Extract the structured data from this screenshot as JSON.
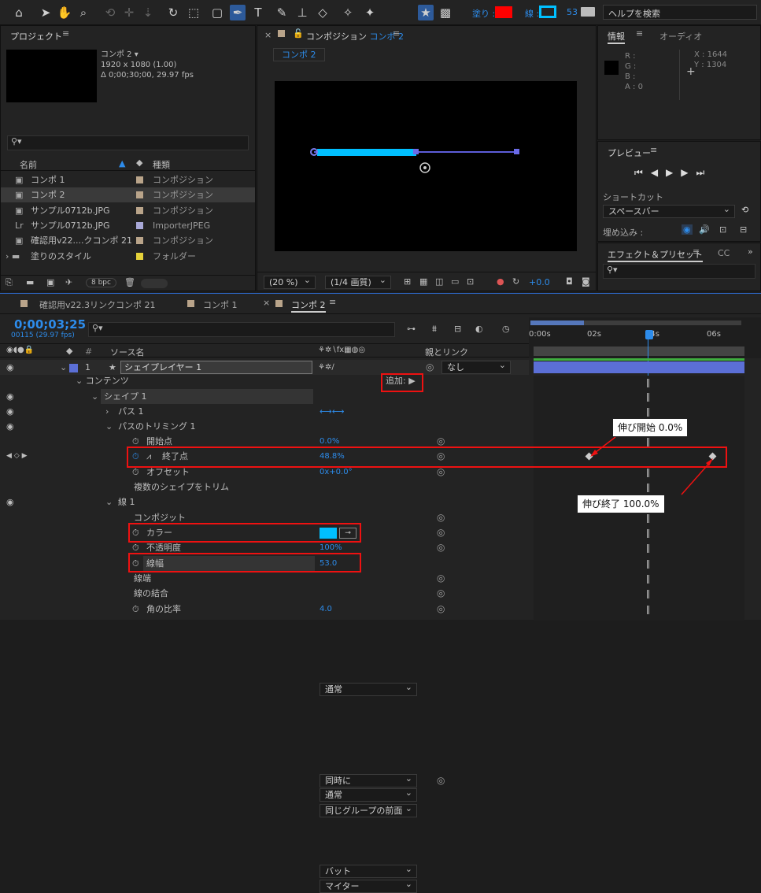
{
  "toolbar": {
    "fill_label": "塗り :",
    "stroke_label": "線 :",
    "stroke_width": "53",
    "help_search": "ヘルプを検索",
    "colors": {
      "fill": "#ff0000",
      "stroke": "#00bfff"
    }
  },
  "project": {
    "title": "プロジェクト",
    "selected_name": "コンポ 2 ▾",
    "selected_info1": "1920 x 1080 (1.00)",
    "selected_info2": "Δ 0;00;30;00, 29.97 fps",
    "col_name": "名前",
    "col_type": "種類",
    "items": [
      {
        "name": "コンポ 1",
        "type": "コンポジション",
        "color": "#b9a48a"
      },
      {
        "name": "コンポ 2",
        "type": "コンポジション",
        "color": "#b9a48a"
      },
      {
        "name": "サンプル0712b.JPG",
        "type": "コンポジション",
        "color": "#b9a48a"
      },
      {
        "name": "サンプル0712b.JPG",
        "type": "ImporterJPEG",
        "color": "#a9a9d8"
      },
      {
        "name": "確認用v22....クコンポ 21",
        "type": "コンポジション",
        "color": "#b9a48a"
      },
      {
        "name": "塗りのスタイル",
        "type": "フォルダー",
        "color": "#e5d23a"
      }
    ],
    "bpc": "8 bpc"
  },
  "composition": {
    "title_prefix": "コンポジション",
    "title_comp": "コンポ 2",
    "tab": "コンポ 2",
    "zoom": "(20 %)",
    "quality": "(1/4 画質)",
    "exposure": "+0.0"
  },
  "info": {
    "tab1": "情報",
    "tab2": "オーディオ",
    "r": "R :",
    "g": "G :",
    "b": "B :",
    "a": "A : 0",
    "x": "X : 1644",
    "y": "Y : 1304"
  },
  "preview": {
    "title": "プレビュー",
    "shortcut_label": "ショートカット",
    "shortcut_value": "スペースバー",
    "embed_label": "埋め込み :"
  },
  "effects": {
    "title": "エフェクト＆プリセット",
    "tab2": "CC"
  },
  "timeline": {
    "tabs": [
      "確認用v22.3リンクコンポ 21",
      "コンポ 1",
      "コンポ 2"
    ],
    "timecode": "0;00;03;25",
    "frames": "00115 (29.97 fps)",
    "col_source": "ソース名",
    "col_parent": "親とリンク",
    "ruler": [
      "0:00s",
      "02s",
      "04s",
      "06s"
    ],
    "layer_num": "1",
    "layer_name": "シェイプレイヤー 1",
    "parent_none": "なし",
    "rows": {
      "contents": "コンテンツ",
      "add": "追加:",
      "shape1": "シェイプ 1",
      "blend_normal": "通常",
      "path1": "パス 1",
      "trim": "パスのトリミング 1",
      "start": "開始点",
      "start_val": "0.0",
      "end": "終了点",
      "end_val": "48.8",
      "offset": "オフセット",
      "offset_val": "0x+0.0°",
      "trim_multi": "複数のシェイプをトリム",
      "trim_multi_val": "同時に",
      "stroke1": "線 1",
      "composite": "コンポジット",
      "composite_val": "同じグループの前面",
      "color": "カラー",
      "opacity": "不透明度",
      "opacity_val": "100",
      "width": "線幅",
      "width_val": "53.0",
      "cap": "線端",
      "cap_val": "バット",
      "join": "線の結合",
      "join_val": "マイター",
      "miter": "角の比率",
      "miter_val": "4.0",
      "percent": "%"
    }
  },
  "callouts": {
    "start": "伸び開始 0.0%",
    "end": "伸び終了 100.0%"
  }
}
